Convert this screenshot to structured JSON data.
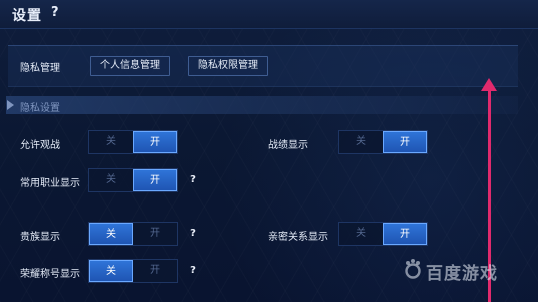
{
  "header": {
    "title": "设置",
    "help": "?"
  },
  "privacy": {
    "label": "隐私管理",
    "personal_info_button": "个人信息管理",
    "permission_button": "隐私权限管理"
  },
  "section": {
    "title": "隐私设置"
  },
  "toggle_labels": {
    "off": "关",
    "on": "开"
  },
  "settings": {
    "allow_spectate": {
      "label": "允许观战",
      "state": "on"
    },
    "record_display": {
      "label": "战绩显示",
      "state": "on"
    },
    "common_role_display": {
      "label": "常用职业显示",
      "state": "on",
      "help": "?"
    },
    "noble_display": {
      "label": "贵族显示",
      "state": "off",
      "help": "?"
    },
    "intimacy_display": {
      "label": "亲密关系显示",
      "state": "on"
    },
    "honor_title_display": {
      "label": "荣耀称号显示",
      "state": "off",
      "help": "?"
    }
  },
  "annotation": {
    "arrow_color": "#e02a6d"
  },
  "watermark": {
    "text": "百度游戏"
  },
  "colors": {
    "accent": "#2f74d8",
    "background": "#0b1833"
  }
}
